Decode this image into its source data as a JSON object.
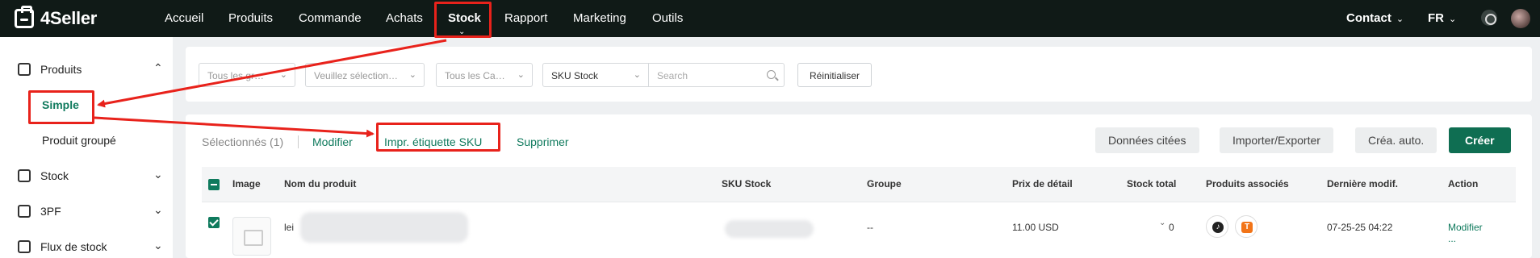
{
  "app": {
    "brand": "4Seller"
  },
  "nav": {
    "items": [
      "Accueil",
      "Produits",
      "Commande",
      "Achats",
      "Stock",
      "Rapport",
      "Marketing",
      "Outils"
    ],
    "active": "Stock",
    "contact": "Contact",
    "language": "FR"
  },
  "sidebar": {
    "sections": [
      {
        "label": "Produits",
        "icon": "box-icon",
        "expanded": true
      },
      {
        "label": "Stock",
        "icon": "layers-icon",
        "expanded": false
      },
      {
        "label": "3PF",
        "icon": "warehouse-icon",
        "expanded": false
      },
      {
        "label": "Flux de stock",
        "icon": "flow-icon",
        "expanded": false
      }
    ],
    "sub_items": [
      "Simple",
      "Produit groupé"
    ],
    "active_sub": "Simple"
  },
  "filters": {
    "group": "Tous les gr…",
    "select1": "Veuillez sélection…",
    "category": "Tous les Ca…",
    "sku_field": "SKU Stock",
    "search_placeholder": "Search",
    "reset": "Réinitialiser"
  },
  "toolbar": {
    "selected": "Sélectionnés (1)",
    "modify": "Modifier",
    "print_label": "Impr. étiquette SKU",
    "delete": "Supprimer",
    "cited_data": "Données citées",
    "import_export": "Importer/Exporter",
    "auto_create": "Créa. auto.",
    "create": "Créer"
  },
  "table": {
    "columns": [
      "Image",
      "Nom du produit",
      "SKU Stock",
      "Groupe",
      "Prix de détail",
      "Stock total",
      "Produits associés",
      "Dernière modif.",
      "Action"
    ],
    "rows": [
      {
        "name": "lei",
        "sku": "",
        "group": "--",
        "price": "11.00 USD",
        "stock": "0",
        "linked": [
          "tiktok",
          "temu"
        ],
        "modified": "07-25-25 04:22",
        "action": "Modifier",
        "more": "..."
      }
    ]
  },
  "colors": {
    "accent": "#0f7a5d",
    "annotation": "#e8221b",
    "topbar": "#101a17"
  }
}
